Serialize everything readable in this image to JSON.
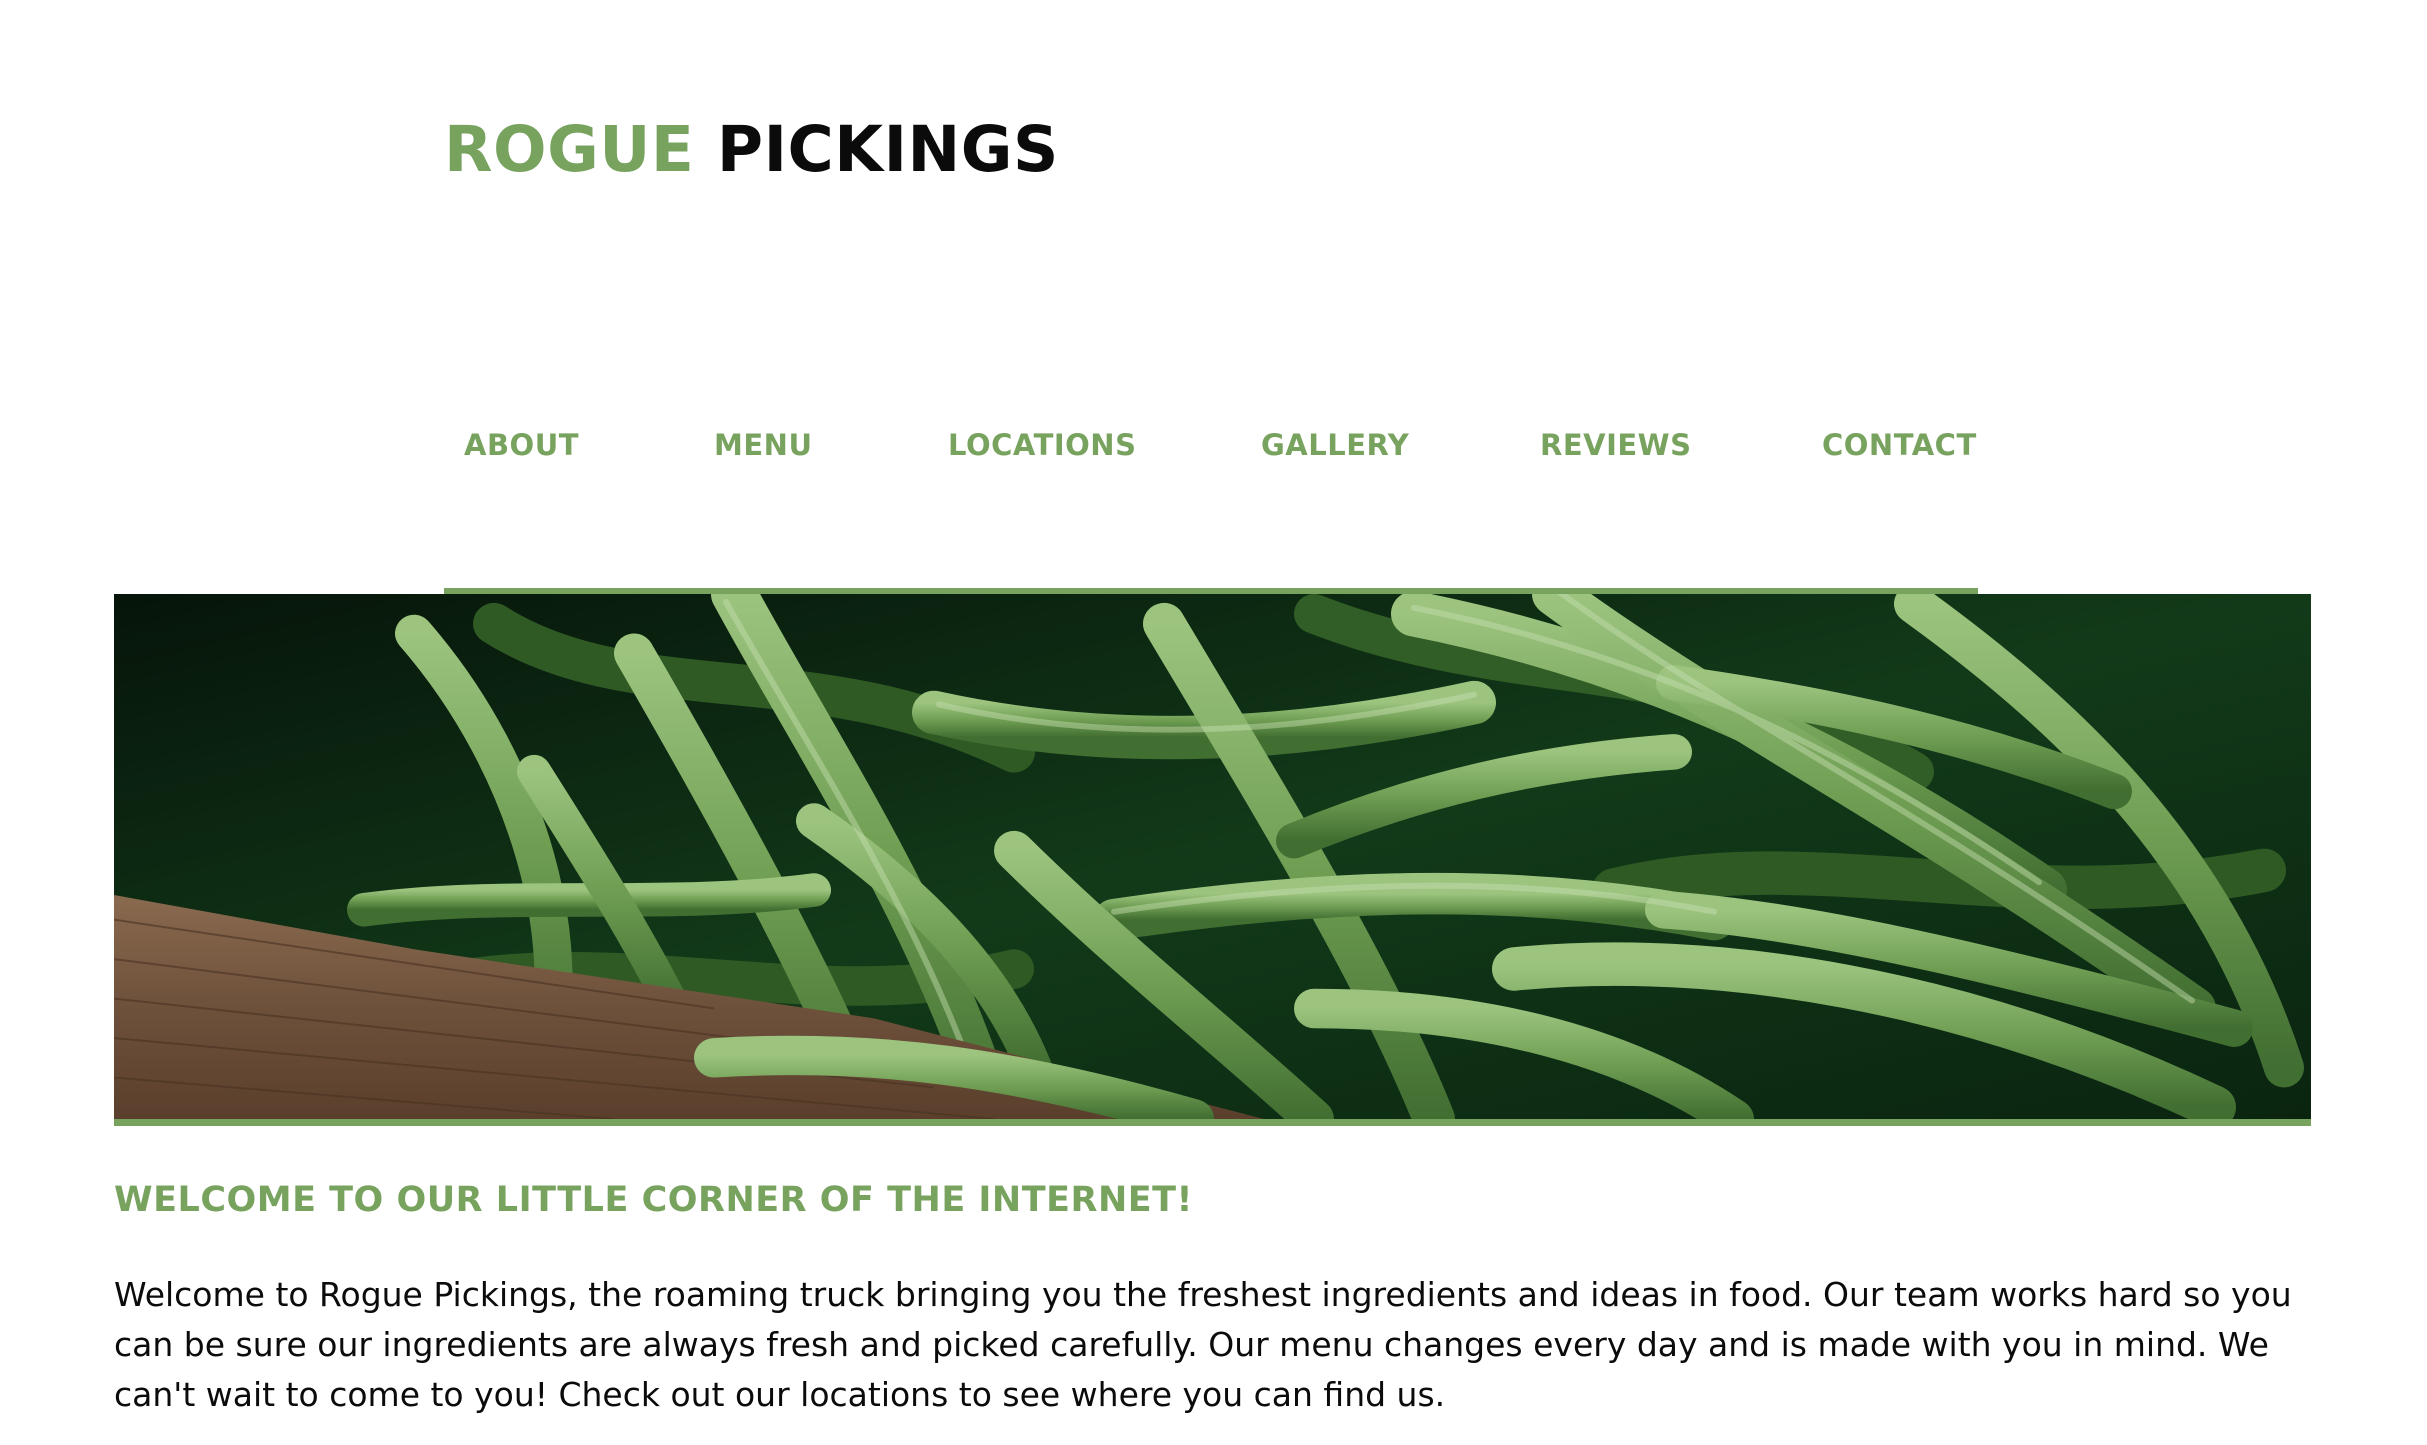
{
  "brand": {
    "word1": "ROGUE",
    "word2": "PICKINGS",
    "accent_color": "#78a35f",
    "dark_color": "#0b0b0b"
  },
  "nav": {
    "items": [
      {
        "label": "ABOUT"
      },
      {
        "label": "MENU"
      },
      {
        "label": "LOCATIONS"
      },
      {
        "label": "GALLERY"
      },
      {
        "label": "REVIEWS"
      },
      {
        "label": "CONTACT"
      }
    ]
  },
  "hero": {
    "subject": "green beans in a wooden crate"
  },
  "content": {
    "heading": "WELCOME TO OUR LITTLE CORNER OF THE INTERNET!",
    "body": "Welcome to Rogue Pickings, the roaming truck bringing you the freshest ingredients and ideas in food. Our team works hard so you can be sure our ingredients are always fresh and picked carefully. Our menu changes every day and is made with you in mind. We can't wait to come to you! Check out our locations to see where you can find us."
  }
}
